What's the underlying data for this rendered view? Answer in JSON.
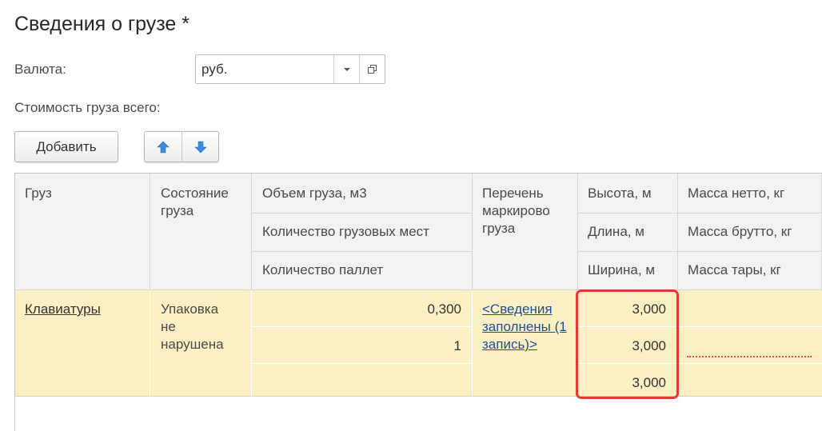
{
  "title": "Сведения о грузе *",
  "currency": {
    "label": "Валюта:",
    "value": "руб."
  },
  "total_label": "Стоимость груза всего:",
  "toolbar": {
    "add_label": "Добавить"
  },
  "table": {
    "headers": {
      "col1": "Груз",
      "col2": "Состояние груза",
      "col3": [
        "Объем груза, м3",
        "Количество грузовых мест",
        "Количество паллет"
      ],
      "col4": "Перечень маркирово груза",
      "col5": [
        "Высота, м",
        "Длина, м",
        "Ширина, м"
      ],
      "col6": [
        "Масса нетто, кг",
        "Масса брутто, кг",
        "Масса тары, кг"
      ]
    },
    "row": {
      "cargo": "Клавиатуры",
      "state": "Упаковка не нарушена",
      "volume": "0,300",
      "places": "1",
      "pallets": "",
      "marking": "<Сведения заполнены (1 запись)>",
      "height": "3,000",
      "length": "3,000",
      "width": "3,000",
      "mass_net": "",
      "mass_gross": "",
      "mass_tare": ""
    }
  },
  "colors": {
    "header_bg": "#f2f2f2",
    "row_bg": "#fbf0c3",
    "link": "#1f4e9c",
    "highlight": "#e53935",
    "arrow": "#3b8be0"
  }
}
